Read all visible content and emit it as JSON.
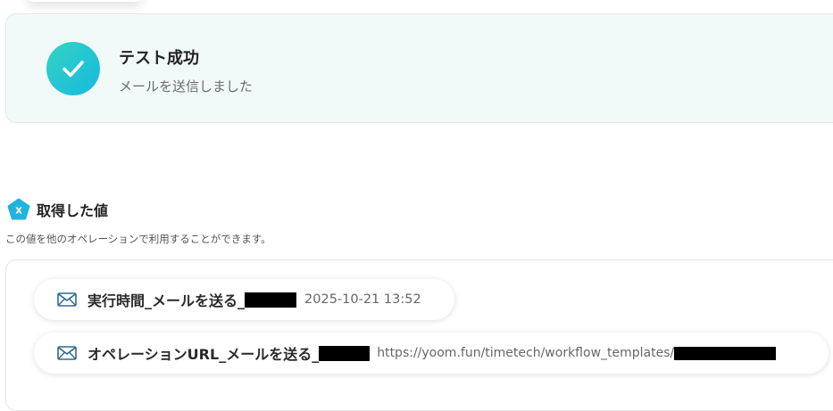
{
  "success": {
    "title": "テスト成功",
    "message": "メールを送信しました",
    "icon": "check-icon",
    "accent_from": "#34d3c3",
    "accent_to": "#16b9e0"
  },
  "obtained": {
    "badge_letter": "x",
    "title": "取得した値",
    "description": "この値を他のオペレーションで利用することができます。",
    "items": [
      {
        "icon": "mail-icon",
        "key": "実行時間_メールを送る_",
        "value": "2025-10-21 13:52"
      },
      {
        "icon": "mail-icon",
        "key": "オペレーションURL_メールを送る_",
        "value": "https://yoom.fun/timetech/workflow_templates/"
      }
    ]
  }
}
